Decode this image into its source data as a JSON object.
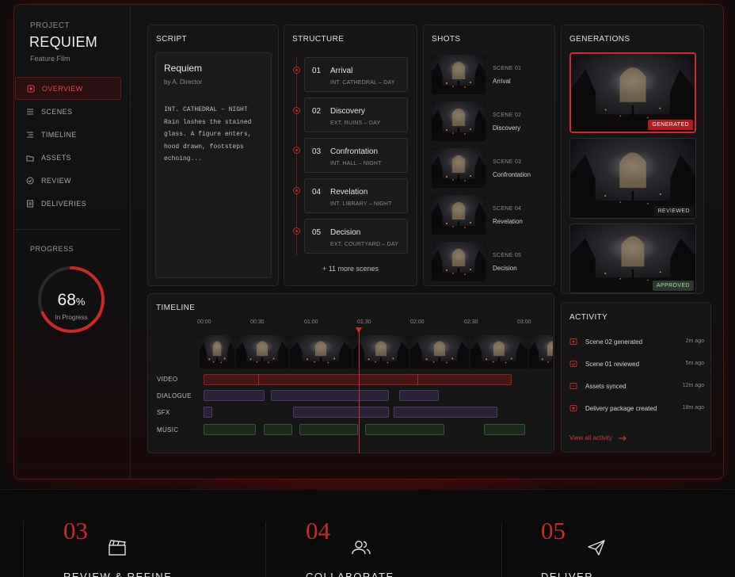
{
  "project": {
    "label": "PROJECT",
    "title": "REQUIEM",
    "subtitle": "Feature Film"
  },
  "nav": [
    {
      "label": "OVERVIEW",
      "icon": "overview-icon",
      "active": true
    },
    {
      "label": "SCENES",
      "icon": "scenes-icon"
    },
    {
      "label": "TIMELINE",
      "icon": "timeline-icon"
    },
    {
      "label": "ASSETS",
      "icon": "assets-icon"
    },
    {
      "label": "REVIEW",
      "icon": "review-icon"
    },
    {
      "label": "DELIVERIES",
      "icon": "deliveries-icon"
    }
  ],
  "progress": {
    "label": "PROGRESS",
    "value": "68",
    "unit": "%",
    "fraction": 0.68,
    "status": "In Progress"
  },
  "script": {
    "title": "SCRIPT",
    "doc_title": "Requiem",
    "author": "by A. Director",
    "lines": [
      "INT. CATHEDRAL – NIGHT",
      "Rain lashes the stained",
      "glass. A figure enters,",
      "hood drawn, footsteps",
      "echoing..."
    ]
  },
  "structure": {
    "title": "STRUCTURE",
    "scenes": [
      {
        "num": "01",
        "name": "Arrival",
        "loc": "INT. CATHEDRAL – DAY"
      },
      {
        "num": "02",
        "name": "Discovery",
        "loc": "EXT. RUINS – DAY"
      },
      {
        "num": "03",
        "name": "Confrontation",
        "loc": "INT. HALL – NIGHT"
      },
      {
        "num": "04",
        "name": "Revelation",
        "loc": "INT. LIBRARY – NIGHT"
      },
      {
        "num": "05",
        "name": "Decision",
        "loc": "EXT. COURTYARD – DAY"
      }
    ],
    "more": "+ 11 more scenes"
  },
  "shots": {
    "title": "SHOTS",
    "items": [
      {
        "scene": "SCENE 01",
        "name": "Arrival"
      },
      {
        "scene": "SCENE 02",
        "name": "Discovery"
      },
      {
        "scene": "SCENE 03",
        "name": "Confrontation"
      },
      {
        "scene": "SCENE 04",
        "name": "Revelation"
      },
      {
        "scene": "SCENE 05",
        "name": "Decision"
      }
    ]
  },
  "generations": {
    "title": "GENERATIONS",
    "items": [
      {
        "badge": "GENERATED"
      },
      {
        "badge": "REVIEWED"
      },
      {
        "badge": "APPROVED"
      }
    ]
  },
  "timeline": {
    "title": "TIMELINE",
    "ticks": [
      "00:00",
      "00:30",
      "01:00",
      "01:30",
      "02:00",
      "02:30",
      "03:00"
    ],
    "tracks": [
      "VIDEO",
      "DIALOGUE",
      "SFX",
      "MUSIC"
    ]
  },
  "activity": {
    "title": "ACTIVITY",
    "items": [
      {
        "text": "Scene 02 generated",
        "time": "2m ago"
      },
      {
        "text": "Scene 01 reviewed",
        "time": "5m ago"
      },
      {
        "text": "Assets synced",
        "time": "12m ago"
      },
      {
        "text": "Delivery package created",
        "time": "18m ago"
      }
    ],
    "link": "View all activity"
  },
  "steps": [
    {
      "num": "03",
      "label": "REVIEW & REFINE",
      "icon": "clapperboard-icon"
    },
    {
      "num": "04",
      "label": "COLLABORATE",
      "icon": "users-icon"
    },
    {
      "num": "05",
      "label": "DELIVER",
      "icon": "send-icon"
    }
  ],
  "colors": {
    "accent": "#c9282a",
    "background": "#0b0b0c",
    "panel": "#151516"
  }
}
